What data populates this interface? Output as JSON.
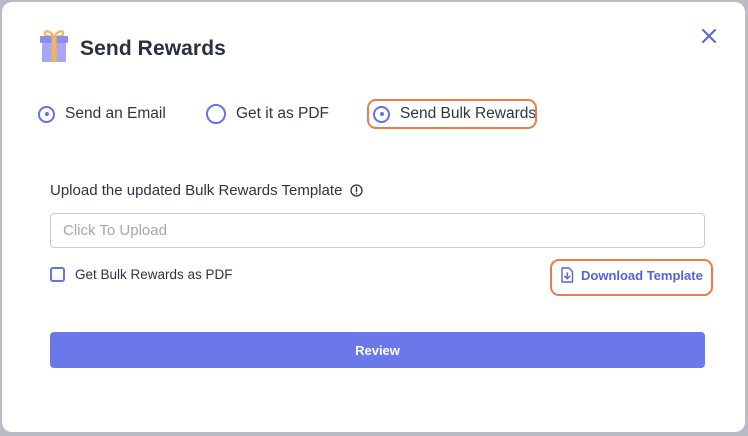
{
  "dialog": {
    "title": "Send Rewards"
  },
  "delivery_options": {
    "send_email": "Send an Email",
    "get_pdf": "Get it as PDF",
    "send_bulk": "Send Bulk Rewards"
  },
  "upload": {
    "label": "Upload the updated Bulk Rewards Template",
    "placeholder": "Click To Upload"
  },
  "options": {
    "bulk_pdf_label": "Get Bulk Rewards as PDF",
    "bulk_pdf_checked": false
  },
  "download": {
    "label": "Download Template"
  },
  "actions": {
    "review_label": "Review"
  },
  "theme": {
    "accent": "#6472e4",
    "highlight": "#ef7a47",
    "button": "#6a78ea"
  },
  "icons": [
    "gift-icon",
    "close-icon",
    "info-icon",
    "file-download-icon"
  ]
}
